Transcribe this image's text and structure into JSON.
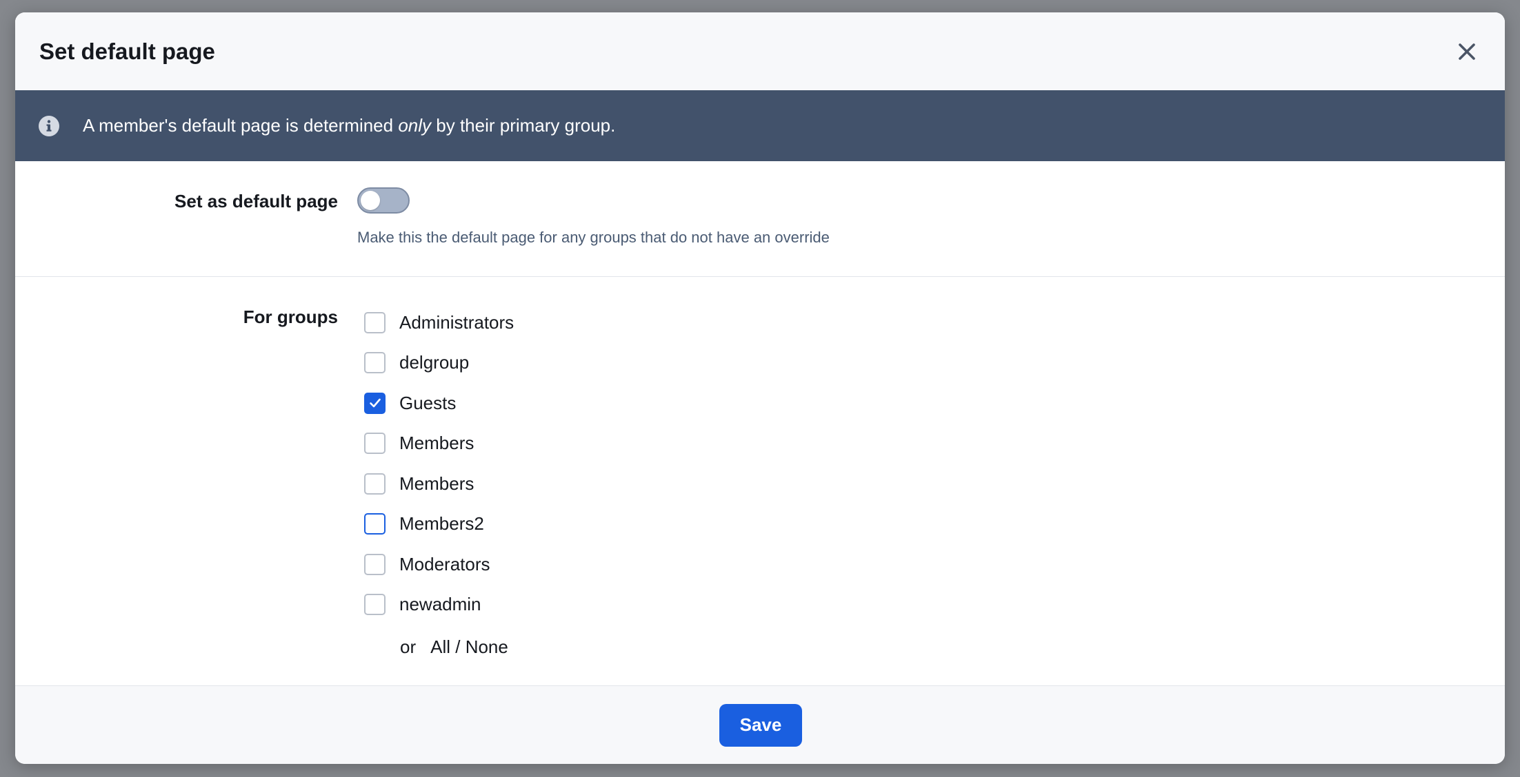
{
  "modal": {
    "title": "Set default page",
    "close_icon": "close-icon"
  },
  "info": {
    "icon": "info-icon",
    "text_before": "A member's default page is determined ",
    "text_emphasis": "only",
    "text_after": " by their primary group."
  },
  "default_page": {
    "label": "Set as default page",
    "toggle_on": false,
    "hint": "Make this the default page for any groups that do not have an override"
  },
  "groups": {
    "label": "For groups",
    "items": [
      {
        "name": "Administrators",
        "checked": false,
        "focused": false
      },
      {
        "name": "delgroup",
        "checked": false,
        "focused": false
      },
      {
        "name": "Guests",
        "checked": true,
        "focused": false
      },
      {
        "name": "Members",
        "checked": false,
        "focused": false
      },
      {
        "name": "Members",
        "checked": false,
        "focused": false
      },
      {
        "name": "Members2",
        "checked": false,
        "focused": true
      },
      {
        "name": "Moderators",
        "checked": false,
        "focused": false
      },
      {
        "name": "newadmin",
        "checked": false,
        "focused": false
      }
    ],
    "or_text": "or",
    "all_none_text": "All / None"
  },
  "footer": {
    "save_label": "Save"
  },
  "colors": {
    "accent": "#1a5fe0",
    "info_bar": "#42526b"
  }
}
